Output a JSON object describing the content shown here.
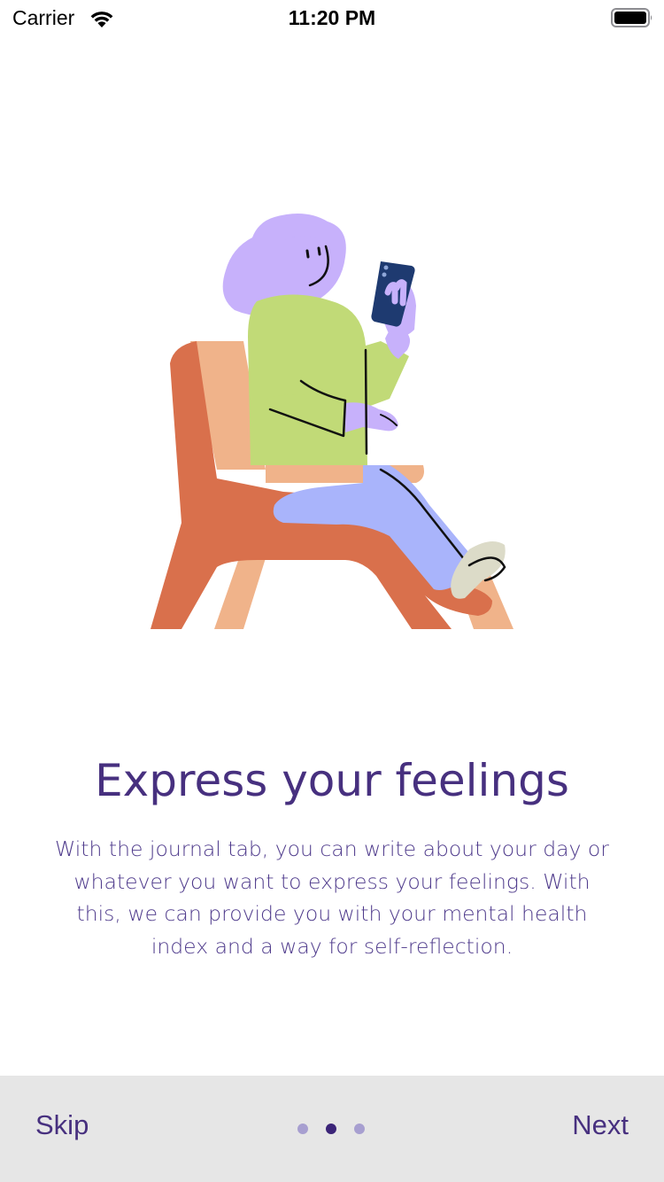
{
  "status_bar": {
    "carrier": "Carrier",
    "time": "11:20 PM",
    "icons": [
      "wifi-icon",
      "battery-icon"
    ]
  },
  "illustration": {
    "description_icon": "person-sitting-in-chair-with-phone-illustration"
  },
  "content": {
    "title": "Express your feelings",
    "description": "With the journal tab, you can write about your day or whatever you want to express your feelings. With this, we can provide you with your  mental health index and a way for self-reflection."
  },
  "bottom_bar": {
    "skip_label": "Skip",
    "next_label": "Next",
    "page_count": 3,
    "current_page": 2
  },
  "colors": {
    "primary_text": "#47307f",
    "bottom_bar_bg": "#e6e6e6",
    "dot_inactive": "#a79fd0",
    "dot_active": "#3b2478"
  }
}
